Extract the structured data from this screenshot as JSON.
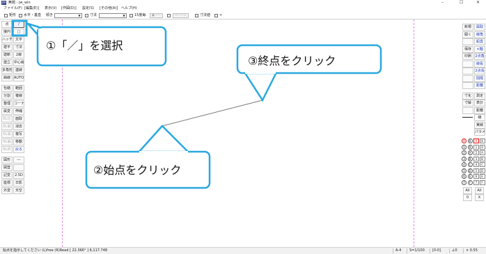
{
  "window": {
    "app_icon": "JW",
    "title": "無題 - jw_win",
    "controls": [
      "–",
      "☐",
      "✕"
    ]
  },
  "menu": [
    "ファイル(F)",
    "[編集(E)]",
    "表示(V)",
    "[作図(D)]",
    "設定(S)",
    "[その他(A)]",
    "ヘルプ(H)"
  ],
  "options": {
    "rect_label": "矩形",
    "horiz_vert_label": "水平・垂直",
    "slope_label": "傾き",
    "slope_value": "",
    "dim_label": "寸法",
    "dim_value": "",
    "fifteen_deg_label": "15度毎",
    "arrow_left_label": "●――",
    "arrow_right_label": "<――>",
    "dim_value_label": "寸法値",
    "lt_label": "<"
  },
  "left_toolbar": {
    "rows": [
      [
        "点",
        "/"
      ],
      [
        "接円",
        "□"
      ],
      [
        "ハッチ",
        "文字"
      ],
      [
        "建平",
        "寸法"
      ],
      [
        "建断",
        "2線"
      ],
      [
        "建立",
        "中心線"
      ],
      [
        "多角形",
        "連線"
      ],
      [
        "曲線",
        "AUTO"
      ],
      [
        "包絡",
        "範囲"
      ],
      [
        "分割",
        "複線"
      ],
      [
        "整理",
        "コーナー"
      ],
      [
        "属変",
        "伸縮"
      ],
      [
        "BL化",
        "面取"
      ],
      [
        "BL解",
        "消去"
      ],
      [
        "BL属",
        "複写"
      ],
      [
        "BL編",
        "移動"
      ],
      [
        "BL終",
        "戻る"
      ],
      [
        "図形",
        "―"
      ],
      [
        "図登",
        ""
      ],
      [
        "記変",
        "2.5D"
      ],
      [
        "座標",
        "日影"
      ],
      [
        "外変",
        "天空"
      ]
    ]
  },
  "right_toolbar": {
    "rows": [
      [
        "新規",
        "属取"
      ],
      [
        "開く",
        "線角"
      ],
      [
        "",
        "鉛直"
      ],
      [
        "保存",
        "×軸"
      ],
      [
        "印刷",
        "2点角"
      ],
      [
        "",
        "線長"
      ],
      [
        "",
        "2点長"
      ],
      [
        "",
        "間隔"
      ],
      [
        "",
        "距離"
      ]
    ],
    "rows2": [
      [
        "寸化",
        "測定"
      ],
      [
        "寸解",
        "表計"
      ],
      [
        "",
        "距離"
      ]
    ],
    "line_label": "線",
    "linetype_label": "実線",
    "layer_group_label": "パラメ",
    "layers": [
      [
        "0",
        "8",
        "0",
        "8"
      ],
      [
        "1",
        "9",
        "1",
        "9"
      ],
      [
        "2",
        "A",
        "2",
        "A"
      ],
      [
        "3",
        "B",
        "3",
        "B"
      ],
      [
        "4",
        "C",
        "4",
        "C"
      ],
      [
        "5",
        "D",
        "5",
        "D"
      ],
      [
        "6",
        "E",
        "6",
        "E"
      ],
      [
        "7",
        "F",
        "7",
        "F"
      ]
    ],
    "all_label_1": "All",
    "all_label_2": "All",
    "zero_label": "0",
    "x_label": "X"
  },
  "status": {
    "message": "始点を指示してください (L)free (R)Read [ 22.366° ] 6,117.748",
    "paper": "A-4",
    "scale": "S=1/100",
    "layer": "[0-0]",
    "angle": "∠0",
    "zoom": "× 0.55"
  },
  "callouts": {
    "step1": "①「／」を選択",
    "step2": "②始点をクリック",
    "step3": "③終点をクリック"
  },
  "colors": {
    "callout_border": "#29a8e0",
    "guide_line": "#e488e4"
  }
}
